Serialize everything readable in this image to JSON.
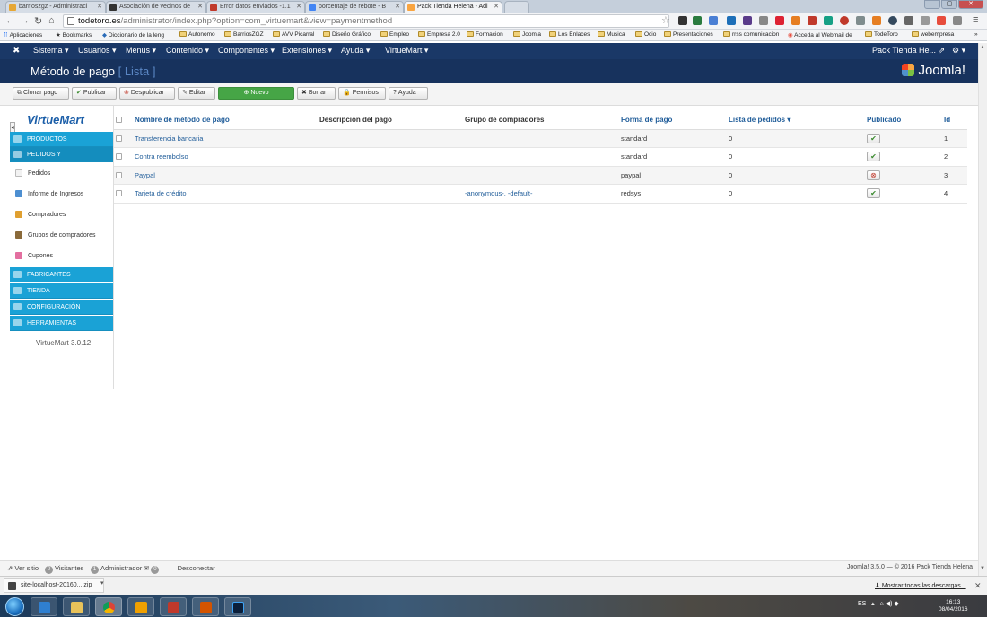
{
  "browser": {
    "tabs": [
      {
        "label": "barrioszgz - Administraci"
      },
      {
        "label": "Asociación de vecinos de"
      },
      {
        "label": "Error datos enviados -1.1"
      },
      {
        "label": "porcentaje de rebote - B"
      },
      {
        "label": "Pack Tienda Helena - Adi"
      }
    ],
    "url_host": "todetoro.es",
    "url_path": "/administrator/index.php?option=com_virtuemart&view=paymentmethod",
    "bookmarks": [
      {
        "label": "Aplicaciones"
      },
      {
        "label": "Bookmarks"
      },
      {
        "label": "Diccionario de la leng"
      },
      {
        "label": "Autonomo"
      },
      {
        "label": "BarriosZGZ"
      },
      {
        "label": "AVV Picarral"
      },
      {
        "label": "Diseño Gráfico"
      },
      {
        "label": "Empleo"
      },
      {
        "label": "Empresa 2.0"
      },
      {
        "label": "Formacion"
      },
      {
        "label": "Joomla"
      },
      {
        "label": "Los Enlaces"
      },
      {
        "label": "Musica"
      },
      {
        "label": "Ocio"
      },
      {
        "label": "Presentaciones"
      },
      {
        "label": "rrss comunicacion"
      },
      {
        "label": "Acceda al Webmail de"
      },
      {
        "label": "TodeToro"
      },
      {
        "label": "webempresa"
      }
    ]
  },
  "joomla_nav": {
    "menus": [
      {
        "label": "Sistema ▾"
      },
      {
        "label": "Usuarios ▾"
      },
      {
        "label": "Menús ▾"
      },
      {
        "label": "Contenido ▾"
      },
      {
        "label": "Componentes ▾"
      },
      {
        "label": "Extensiones ▾"
      },
      {
        "label": "Ayuda ▾"
      },
      {
        "label": "VirtueMart ▾"
      }
    ],
    "site_name": "Pack Tienda He...",
    "settings_label": "⚙ ▾"
  },
  "header": {
    "title": "Método de pago",
    "subtitle": "[ Lista ]",
    "logo_text": "Joomla!"
  },
  "toolbar": {
    "buttons": [
      {
        "label": "Clonar pago",
        "icon": "⧉"
      },
      {
        "label": "Publicar",
        "icon": "✔"
      },
      {
        "label": "Despublicar",
        "icon": "⊗"
      },
      {
        "label": "Editar",
        "icon": "✎"
      },
      {
        "label": "Nuevo",
        "icon": "⊕"
      },
      {
        "label": "Borrar",
        "icon": "✖"
      },
      {
        "label": "Permisos",
        "icon": "🔒"
      },
      {
        "label": "Ayuda",
        "icon": "?"
      }
    ]
  },
  "sidebar": {
    "logo": "VirtueMart",
    "sections_top": [
      {
        "label": "PRODUCTOS"
      },
      {
        "label": "PEDIDOS Y"
      }
    ],
    "items": [
      {
        "label": "Pedidos",
        "color": "#e8e8e8"
      },
      {
        "label": "Informe de Ingresos",
        "color": "#4d8fd1"
      },
      {
        "label": "Compradores",
        "color": "#e0a030"
      },
      {
        "label": "Grupos de compradores",
        "color": "#8a6a3a"
      },
      {
        "label": "Cupones",
        "color": "#e36fa0"
      }
    ],
    "sections_bottom": [
      {
        "label": "FABRICANTES"
      },
      {
        "label": "TIENDA"
      },
      {
        "label": "CONFIGURACIÓN"
      },
      {
        "label": "HERRAMIENTAS"
      }
    ],
    "version": "VirtueMart 3.0.12"
  },
  "table": {
    "headers": {
      "name": "Nombre de método de pago",
      "description": "Descripción del pago",
      "group": "Grupo de compradores",
      "form": "Forma de pago",
      "orders": "Lista de pedidos ▾",
      "published": "Publicado",
      "id": "Id"
    },
    "rows": [
      {
        "name": "Transferencia bancaria",
        "description": "",
        "group": "",
        "form": "standard",
        "orders": "0",
        "published": true,
        "id": "1"
      },
      {
        "name": "Contra reembolso",
        "description": "",
        "group": "",
        "form": "standard",
        "orders": "0",
        "published": true,
        "id": "2"
      },
      {
        "name": "Paypal",
        "description": "",
        "group": "",
        "form": "paypal",
        "orders": "0",
        "published": false,
        "id": "3"
      },
      {
        "name": "Tarjeta de crédito",
        "description": "",
        "group": "-anonymous-, -default-",
        "form": "redsys",
        "orders": "0",
        "published": true,
        "id": "4"
      }
    ]
  },
  "footer": {
    "view_site": "Ver sitio",
    "visitors_count": "0",
    "visitors_label": "Visitantes",
    "admin_count": "1",
    "admin_label": "Administrador",
    "messages_count": "0",
    "logout": "Desconectar",
    "copyright": "Joomla! 3.5.0 — © 2016 Pack Tienda Helena"
  },
  "downloads": {
    "file": "site-localhost-20160....zip",
    "show_all": "Mostrar todas las descargas..."
  },
  "taskbar": {
    "language": "ES",
    "time": "16:13",
    "date": "08/04/2016"
  }
}
